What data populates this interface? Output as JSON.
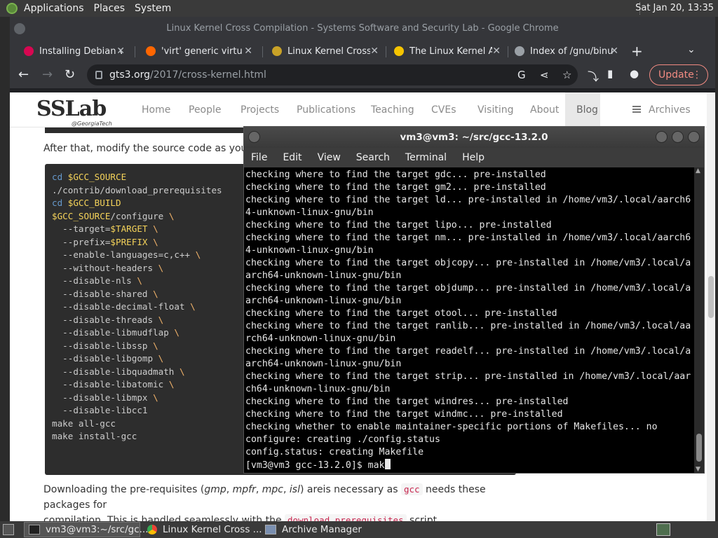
{
  "top_panel": {
    "menus": [
      "Applications",
      "Places",
      "System"
    ],
    "clock": "Sat Jan 20, 13:35"
  },
  "chrome": {
    "window_title": "Linux Kernel Cross Compilation - Systems Software and Security Lab - Google Chrome",
    "tabs": [
      {
        "label": "Installing Debian v",
        "icon": "debian-icon",
        "color": "#d70751"
      },
      {
        "label": "'virt' generic virtu",
        "icon": "qemu-icon",
        "color": "#ff6600"
      },
      {
        "label": "Linux Kernel Cross",
        "icon": "sslab-icon",
        "color": "#c9a227"
      },
      {
        "label": "The Linux Kernel A",
        "icon": "tux-icon",
        "color": "#f5c400"
      },
      {
        "label": "Index of /gnu/binut",
        "icon": "globe-icon",
        "color": "#9aa0a6"
      }
    ],
    "url_host": "gts3.org",
    "url_path": "/2017/cross-kernel.html",
    "update_label": "Update"
  },
  "site": {
    "logo": "SSLab",
    "logo_sub": "@GeorgiaTech",
    "nav": [
      "Home",
      "People",
      "Projects",
      "Publications",
      "Teaching",
      "CVEs",
      "Visiting",
      "About",
      "Blog",
      "Archives"
    ],
    "intro_text": "After that, modify the source code as you wish",
    "code_lines": [
      [
        "cd ",
        "$GCC_SOURCE",
        ""
      ],
      [
        "./contrib/download_prerequisites",
        "",
        ""
      ],
      [
        "",
        "",
        ""
      ],
      [
        "cd ",
        "$GCC_BUILD",
        ""
      ],
      [
        "",
        "$GCC_SOURCE",
        "/configure \\"
      ],
      [
        "  --target=",
        "$TARGET",
        " \\"
      ],
      [
        "  --prefix=",
        "$PREFIX",
        " \\"
      ],
      [
        "  --enable-languages=c,c++",
        "",
        " \\"
      ],
      [
        "  --without-headers",
        "",
        " \\"
      ],
      [
        "  --disable-nls",
        "",
        " \\"
      ],
      [
        "  --disable-shared",
        "",
        " \\"
      ],
      [
        "  --disable-decimal-float",
        "",
        " \\"
      ],
      [
        "  --disable-threads",
        "",
        " \\"
      ],
      [
        "  --disable-libmudflap",
        "",
        " \\"
      ],
      [
        "  --disable-libssp",
        "",
        " \\"
      ],
      [
        "  --disable-libgomp",
        "",
        " \\"
      ],
      [
        "  --disable-libquadmath",
        "",
        " \\"
      ],
      [
        "  --disable-libatomic",
        "",
        " \\"
      ],
      [
        "  --disable-libmpx",
        "",
        " \\"
      ],
      [
        "  --disable-libcc1",
        "",
        ""
      ],
      [
        "",
        "",
        ""
      ],
      [
        "make all-gcc",
        "",
        ""
      ],
      [
        "make install-gcc",
        "",
        ""
      ]
    ],
    "para_1": "Downloading the pre-requisites (",
    "para_gmp": "gmp",
    "para_mpfr": "mpfr",
    "para_mpc": "mpc",
    "para_isl": "isl",
    "para_2": ") areis necessary as ",
    "para_code1": "gcc",
    "para_3": " needs these packages for",
    "para_4": "compilation. This is handled seamlessly with the ",
    "para_code2": "download_prerequisites",
    "para_5": " script."
  },
  "terminal": {
    "title": "vm3@vm3: ~/src/gcc-13.2.0",
    "menus": [
      "File",
      "Edit",
      "View",
      "Search",
      "Terminal",
      "Help"
    ],
    "lines": [
      "checking where to find the target gdc... pre-installed",
      "checking where to find the target gm2... pre-installed",
      "checking where to find the target ld... pre-installed in /home/vm3/.local/aarch6",
      "4-unknown-linux-gnu/bin",
      "checking where to find the target lipo... pre-installed",
      "checking where to find the target nm... pre-installed in /home/vm3/.local/aarch6",
      "4-unknown-linux-gnu/bin",
      "checking where to find the target objcopy... pre-installed in /home/vm3/.local/a",
      "arch64-unknown-linux-gnu/bin",
      "checking where to find the target objdump... pre-installed in /home/vm3/.local/a",
      "arch64-unknown-linux-gnu/bin",
      "checking where to find the target otool... pre-installed",
      "checking where to find the target ranlib... pre-installed in /home/vm3/.local/aa",
      "rch64-unknown-linux-gnu/bin",
      "checking where to find the target readelf... pre-installed in /home/vm3/.local/a",
      "arch64-unknown-linux-gnu/bin",
      "checking where to find the target strip... pre-installed in /home/vm3/.local/aar",
      "ch64-unknown-linux-gnu/bin",
      "checking where to find the target windres... pre-installed",
      "checking where to find the target windmc... pre-installed",
      "checking whether to enable maintainer-specific portions of Makefiles... no",
      "configure: creating ./config.status",
      "config.status: creating Makefile"
    ],
    "prompt": "[vm3@vm3 gcc-13.2.0]$ mak"
  },
  "taskbar": {
    "items": [
      {
        "label": "vm3@vm3:~/src/gc...",
        "icon": "terminal-icon"
      },
      {
        "label": "Linux Kernel Cross ...",
        "icon": "chrome-icon"
      },
      {
        "label": "Archive Manager",
        "icon": "archive-manager-icon"
      }
    ]
  }
}
